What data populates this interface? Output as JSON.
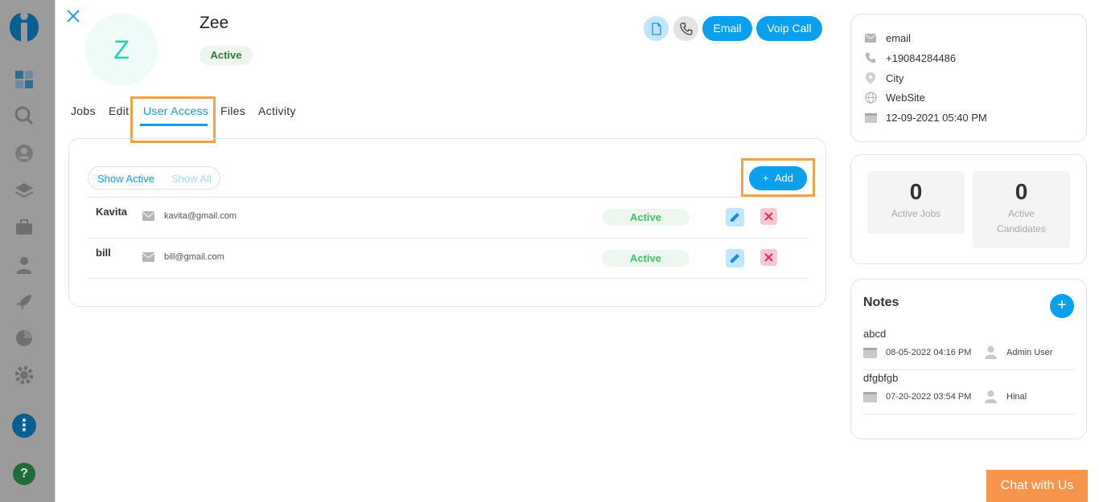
{
  "contact": {
    "avatar_letter": "Z",
    "name": "Zee",
    "status": "Active"
  },
  "header_actions": {
    "email_label": "Email",
    "voip_label": "Voip Call"
  },
  "tabs": [
    {
      "label": "Jobs"
    },
    {
      "label": "Edit"
    },
    {
      "label": "User Access",
      "active": true
    },
    {
      "label": "Files"
    },
    {
      "label": "Activity"
    }
  ],
  "user_access": {
    "filter": {
      "show_active": "Show Active",
      "show_all": "Show All"
    },
    "add_label": "Add",
    "users": [
      {
        "name": "Kavita",
        "email": "kavita@gmail.com",
        "status": "Active"
      },
      {
        "name": "bill",
        "email": "bill@gmail.com",
        "status": "Active"
      }
    ]
  },
  "info": {
    "email": "email",
    "phone": "+19084284486",
    "city": "City",
    "website": "WebSite",
    "created": "12-09-2021 05:40 PM"
  },
  "stats": [
    {
      "value": "0",
      "label": "Active Jobs"
    },
    {
      "value": "0",
      "label": "Active Candidates"
    }
  ],
  "notes": {
    "title": "Notes",
    "add_symbol": "+",
    "items": [
      {
        "text": "abcd",
        "date": "08-05-2022 04:16 PM",
        "user": "Admin User"
      },
      {
        "text": "dfgbfgb",
        "date": "07-20-2022 03:54 PM",
        "user": "Hinal"
      }
    ]
  },
  "chat": {
    "label": "Chat with Us"
  },
  "sidebar": {
    "more_symbol": "⋮",
    "help_symbol": "?"
  },
  "colors": {
    "accent": "#0aa0ee",
    "highlight": "#f2a34a",
    "active_green": "#43c06a",
    "chat_orange": "#f7954d"
  }
}
